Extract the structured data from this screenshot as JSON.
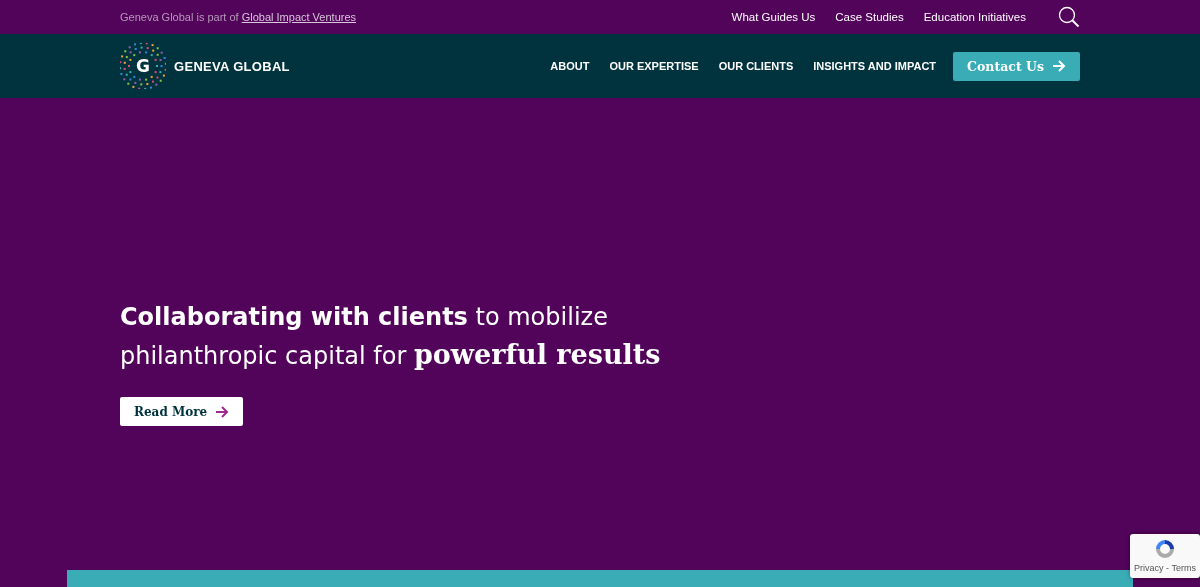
{
  "top_bar": {
    "note": "Geneva Global is part of",
    "note_link": "Global Impact Ventures",
    "links": [
      "What Guides Us",
      "Case Studies",
      "Education Initiatives"
    ]
  },
  "nav": {
    "logo_letter": "G",
    "logo_text": "GENEVA GLOBAL",
    "items": [
      "ABOUT",
      "OUR EXPERTISE",
      "OUR CLIENTS",
      "INSIGHTS AND IMPACT"
    ],
    "cta": "Contact Us"
  },
  "hero": {
    "headline": "**Collaborating with clients** to mobilize philanthropic capital for **powerful results**",
    "button": "Read More"
  },
  "recaptcha": {
    "links": "Privacy - Terms"
  }
}
